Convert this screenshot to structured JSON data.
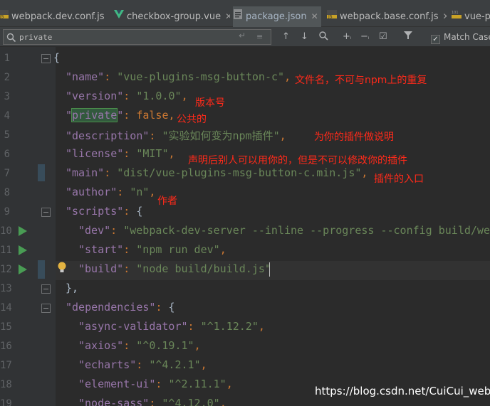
{
  "tabs": [
    {
      "label": "webpack.dev.conf.js",
      "icon": "js-file-icon",
      "active": false
    },
    {
      "label": "checkbox-group.vue",
      "icon": "vue-file-icon",
      "active": false
    },
    {
      "label": "package.json",
      "icon": "json-file-icon",
      "active": true
    },
    {
      "label": "webpack.base.conf.js",
      "icon": "js-file-icon",
      "active": false
    },
    {
      "label": "vue-pl",
      "icon": "binary-file-icon",
      "active": false
    }
  ],
  "search": {
    "value": "private",
    "match_case_label": "Match Case",
    "match_case_checked": true
  },
  "lines": {
    "n1": "1",
    "n2": "2",
    "n3": "3",
    "n4": "4",
    "n5": "5",
    "n6": "6",
    "n7": "7",
    "n8": "8",
    "n9": "9",
    "n10": "10",
    "n11": "11",
    "n12": "12",
    "n13": "13",
    "n14": "14",
    "n15": "15",
    "n16": "16",
    "n17": "17",
    "n18": "18",
    "n19": "19"
  },
  "code": {
    "l1": "{",
    "l2_key": "\"name\"",
    "l2_val": "\"vue-plugins-msg-button-c\"",
    "l3_key": "\"version\"",
    "l3_val": "\"1.0.0\"",
    "l4_key_pre": "\"",
    "l4_key_hl": "private",
    "l4_key_post": "\"",
    "l4_val": "false",
    "l5_key": "\"description\"",
    "l5_val": "\"实验如何变为npm插件\"",
    "l6_key": "\"license\"",
    "l6_val": "\"MIT\"",
    "l7_key": "\"main\"",
    "l7_val": "\"dist/vue-plugins-msg-button-c.min.js\"",
    "l8_key": "\"author\"",
    "l8_val": "\"n\"",
    "l9_key": "\"scripts\"",
    "l10_key": "\"dev\"",
    "l10_val": "\"webpack-dev-server --inline --progress --config build/web",
    "l11_key": "\"start\"",
    "l11_val": "\"npm run dev\"",
    "l12_key": "\"build\"",
    "l12_val": "\"node build/build.js\"",
    "l13": "},",
    "l14_key": "\"dependencies\"",
    "l15_key": "\"async-validator\"",
    "l15_val": "\"^1.12.2\"",
    "l16_key": "\"axios\"",
    "l16_val": "\"^0.19.1\"",
    "l17_key": "\"echarts\"",
    "l17_val": "\"^4.2.1\"",
    "l18_key": "\"element-ui\"",
    "l18_val": "\"^2.11.1\"",
    "l19_key": "\"node-sass\"",
    "l19_val": "\"^4.12.0\""
  },
  "annotations": {
    "a2": "文件名，不可与npm上的重复",
    "a3": "版本号",
    "a4": "公共的",
    "a5": "为你的插件做说明",
    "a6": "声明后别人可以用你的，但是不可以修改你的插件",
    "a7": "插件的入口",
    "a8": "作者"
  },
  "watermark": "https://blog.csdn.net/CuiCui_web",
  "colors": {
    "key": "#9876aa",
    "string": "#6a8759",
    "keyword": "#cc7832",
    "annotation": "#ff2a1a",
    "background": "#2b2b2b"
  }
}
